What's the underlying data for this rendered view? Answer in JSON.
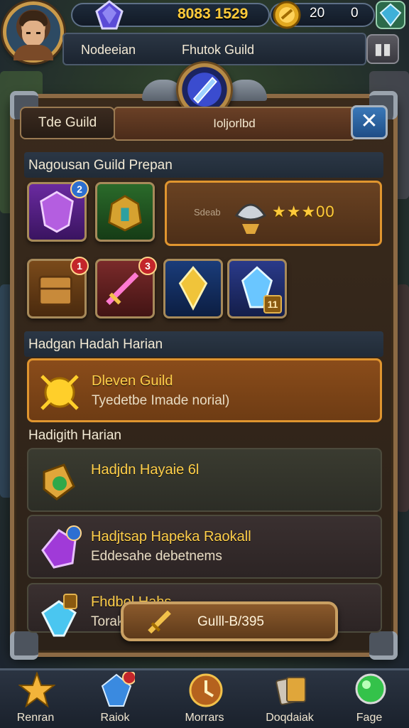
{
  "hud": {
    "gold_amount": "8083 1529",
    "coin_amount": "20",
    "coin_amount_2": "0",
    "tabs": [
      "Nodeeian",
      "Fhutok Guild"
    ],
    "menu_icon": "menu-icon"
  },
  "panel": {
    "tab_left": "Tde Guild",
    "tab_active": "Ioljorlbd",
    "close_label": "✕",
    "section_1": "Nagousan Guild Prepan",
    "section_2": "Hadgan Hadah Harian",
    "section_3": "Hadigith Harian",
    "reward_card": {
      "label": "Sdeab",
      "stars": "★★★00"
    },
    "slots": [
      {
        "icon": "purple-shield-icon",
        "badge": "2"
      },
      {
        "icon": "green-helm-icon",
        "badge": ""
      },
      {
        "icon": "treasure-chest-icon",
        "badge": "1"
      },
      {
        "icon": "magic-sword-icon",
        "badge": "3"
      },
      {
        "icon": "blue-crystal-icon",
        "badge": ""
      },
      {
        "icon": "ice-gem-icon",
        "badge": "11"
      }
    ],
    "tasks": [
      {
        "title": "Dleven Guild",
        "desc": "Tyedetbe Imade norial)",
        "icon": "gold-coin-icon"
      },
      {
        "title": "Hadjdn Hayaie 6l",
        "desc": "",
        "icon": "green-amulet-icon"
      },
      {
        "title": "Hadjtsap Hapeka Raokall",
        "desc": "Eddesahe debetnems",
        "icon": "purple-rune-icon"
      },
      {
        "title": "Fhdbol Hahs",
        "desc": "Torak",
        "icon": "blue-diamond-icon"
      }
    ],
    "claim_button": "Gulll-B/395"
  },
  "nav": [
    {
      "label": "Renran",
      "icon": "star-icon"
    },
    {
      "label": "Raiok",
      "icon": "blue-gem-icon",
      "badge": "3"
    },
    {
      "label": "Morrars",
      "icon": "clock-shield-icon"
    },
    {
      "label": "Doqdaiak",
      "icon": "cards-icon"
    },
    {
      "label": "Fage",
      "icon": "green-orb-icon"
    }
  ]
}
